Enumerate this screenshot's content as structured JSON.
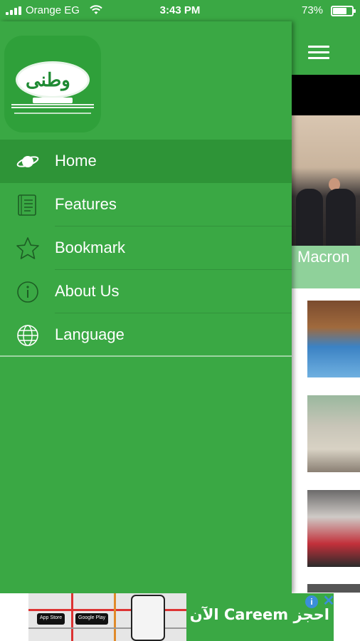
{
  "status_bar": {
    "carrier": "Orange EG",
    "time": "3:43 PM",
    "battery": "73%"
  },
  "drawer": {
    "menu": [
      {
        "label": "Home",
        "icon": "planet-icon",
        "active": true
      },
      {
        "label": "Features",
        "icon": "document-icon",
        "active": false
      },
      {
        "label": "Bookmark",
        "icon": "star-icon",
        "active": false
      },
      {
        "label": "About Us",
        "icon": "info-icon",
        "active": false
      },
      {
        "label": "Language",
        "icon": "globe-icon",
        "active": false
      }
    ]
  },
  "content": {
    "hero_title": "Macron"
  },
  "ad": {
    "headline": "احجز Careem الآن",
    "store_badges": [
      "App Store",
      "Google Play"
    ]
  },
  "colors": {
    "primary_green": "#3aa844",
    "active_item": "#2e9437",
    "hero_label_bg": "#8fd19a"
  }
}
